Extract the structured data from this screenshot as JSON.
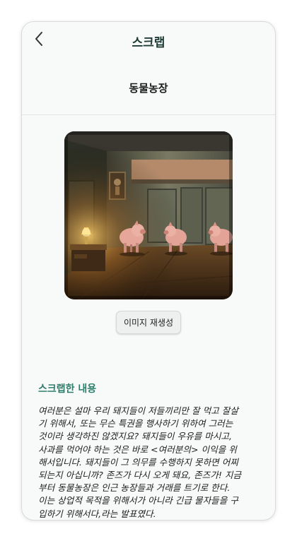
{
  "header": {
    "title": "스크랩",
    "back_icon": "chevron-left-icon"
  },
  "book": {
    "title": "동물농장"
  },
  "illustration": {
    "description_icon": "generated-illustration",
    "colors": {
      "wall": "#6f7561",
      "floor": "#5a3a1f",
      "lamp": "#ffd56b",
      "pig": "#e6a79a"
    }
  },
  "actions": {
    "regenerate_label": "이미지 재생성"
  },
  "scrap": {
    "heading": "스크랩한 내용",
    "lines": [
      "여러분은 설마 우리 돼지들이 저들끼리만 잘 먹고 잘살",
      "기 위해서, 또는 무슨 특권을 행사하기 위하여 그러는",
      "것이라 생각하진 않겠지요? 돼지들이 우유를 마시고,",
      "사과를 먹어야 하는 것은 바로 <여러분의> 이익을 위",
      "해서입니다. 돼지들이 그 의무를 수행하지 못하면 어찌",
      "되는지 아십니까? 존즈가 다시 오게 돼요, 존즈가! 지금",
      "부터 동물농장은 인근 농장들과 거래를 트기로 한다.",
      "이는 상업적 목적을 위해서가 아니라 긴급 물자들을 구",
      "입하기 위해서다,라는 발표였다."
    ]
  },
  "theme": {
    "accent": "#2e7d6b",
    "title_color": "#1f3b35",
    "surface": "#f8faf9"
  }
}
